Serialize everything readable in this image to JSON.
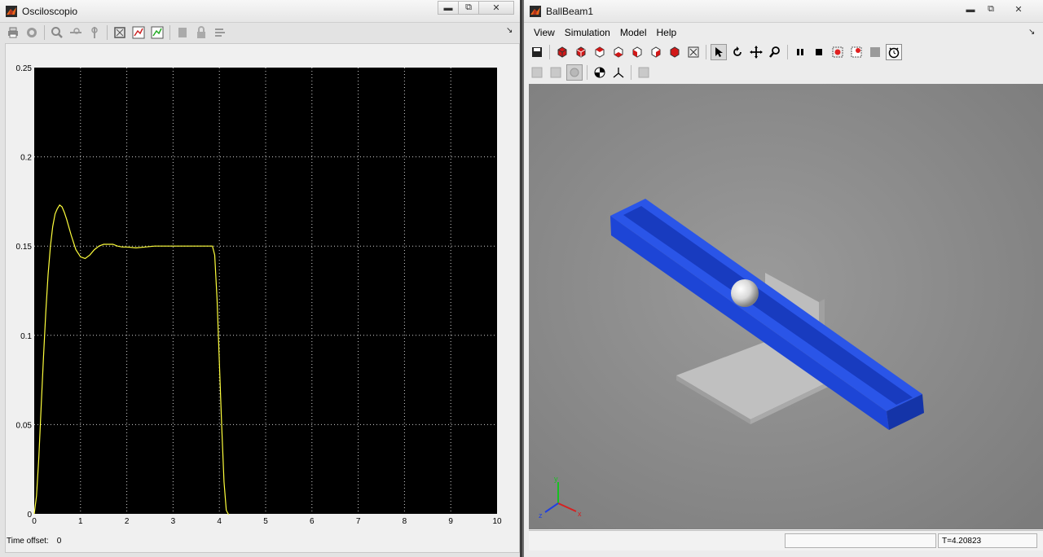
{
  "scope": {
    "title": "Osciloscopio",
    "time_offset_label": "Time offset:",
    "time_offset_value": "0",
    "toolbar_icons": [
      "print-icon",
      "parameters-icon",
      "zoom-icon",
      "zoom-x-icon",
      "zoom-y-icon",
      "autoscale-icon",
      "save-axes-icon",
      "restore-axes-icon",
      "floating-scope-icon",
      "lock-icon",
      "signal-selection-icon"
    ]
  },
  "vr": {
    "title": "BallBeam1",
    "menu": [
      "View",
      "Simulation",
      "Model",
      "Help"
    ],
    "status_time": "T=4.20823",
    "axis_labels": {
      "x": "x",
      "y": "y",
      "z": "z"
    },
    "beam_color": "#1f47d8"
  },
  "chart_data": {
    "type": "line",
    "title": "",
    "xlabel": "",
    "ylabel": "",
    "xlim": [
      0,
      10
    ],
    "ylim": [
      0,
      0.25
    ],
    "xticks": [
      "0",
      "1",
      "2",
      "3",
      "4",
      "5",
      "6",
      "7",
      "8",
      "9",
      "10"
    ],
    "yticks": [
      "0",
      "0.05",
      "0.1",
      "0.15",
      "0.2",
      "0.25"
    ],
    "grid": true,
    "series": [
      {
        "color": "#ffff3c",
        "x": [
          0,
          0.05,
          0.1,
          0.15,
          0.2,
          0.25,
          0.3,
          0.35,
          0.4,
          0.45,
          0.5,
          0.55,
          0.6,
          0.65,
          0.7,
          0.8,
          0.9,
          1.0,
          1.1,
          1.2,
          1.3,
          1.4,
          1.5,
          1.6,
          1.7,
          1.8,
          1.9,
          2.0,
          2.2,
          2.4,
          2.6,
          3.0,
          3.5,
          3.85,
          3.9,
          3.95,
          4.0,
          4.05,
          4.1,
          4.15,
          4.2
        ],
        "y": [
          0,
          0.01,
          0.032,
          0.06,
          0.088,
          0.113,
          0.134,
          0.15,
          0.161,
          0.168,
          0.171,
          0.173,
          0.172,
          0.169,
          0.165,
          0.156,
          0.148,
          0.144,
          0.143,
          0.145,
          0.148,
          0.15,
          0.151,
          0.151,
          0.151,
          0.15,
          0.1495,
          0.1495,
          0.149,
          0.1495,
          0.15,
          0.15,
          0.15,
          0.15,
          0.145,
          0.12,
          0.085,
          0.05,
          0.018,
          0.002,
          -0.01
        ]
      }
    ]
  }
}
